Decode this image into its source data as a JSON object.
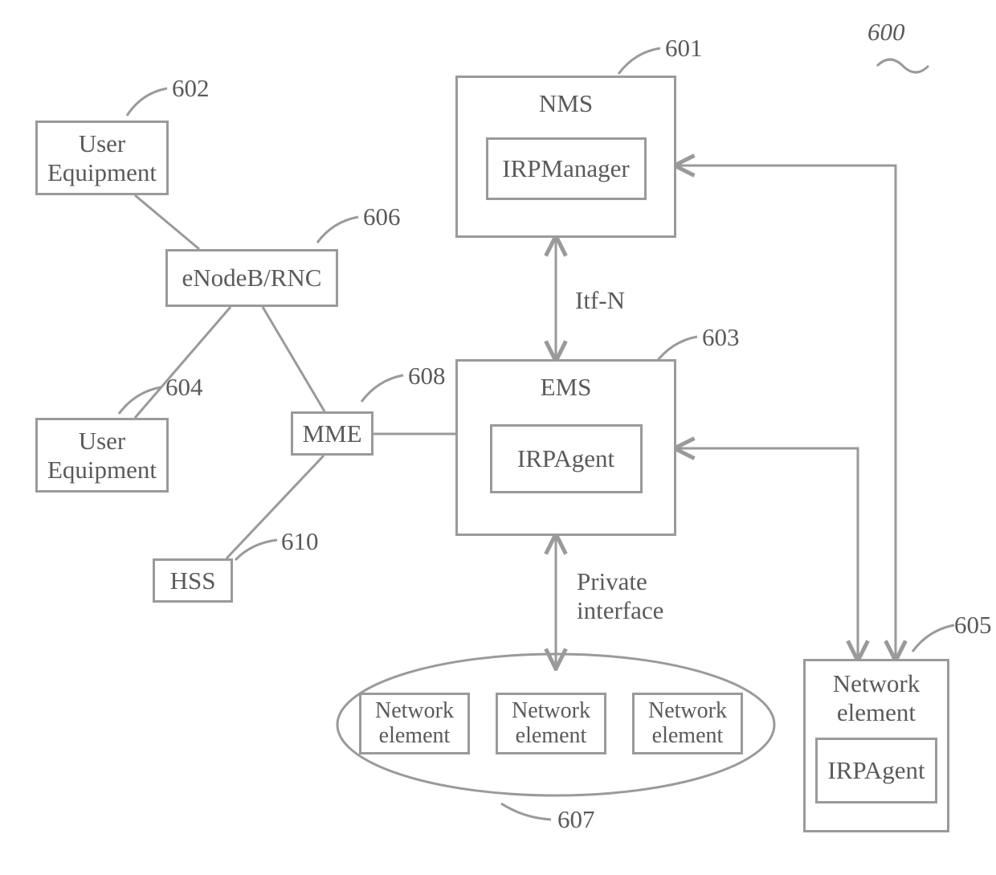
{
  "refs": {
    "figure": "600",
    "nms": "601",
    "ue1": "602",
    "ems": "603",
    "ue2": "604",
    "ne_irp": "605",
    "enodeb": "606",
    "ne_group": "607",
    "mme": "608",
    "hss": "610"
  },
  "boxes": {
    "ue1": "User\nEquipment",
    "ue2": "User\nEquipment",
    "enodeb": "eNodeB/RNC",
    "mme": "MME",
    "hss": "HSS",
    "nms_title": "NMS",
    "nms_inner": "IRPManager",
    "ems_title": "EMS",
    "ems_inner": "IRPAgent",
    "ne_irp_title": "Network\nelement",
    "ne_irp_inner": "IRPAgent",
    "ne_small": "Network\nelement"
  },
  "links": {
    "itfn": "Itf-N",
    "private": "Private\ninterface"
  }
}
